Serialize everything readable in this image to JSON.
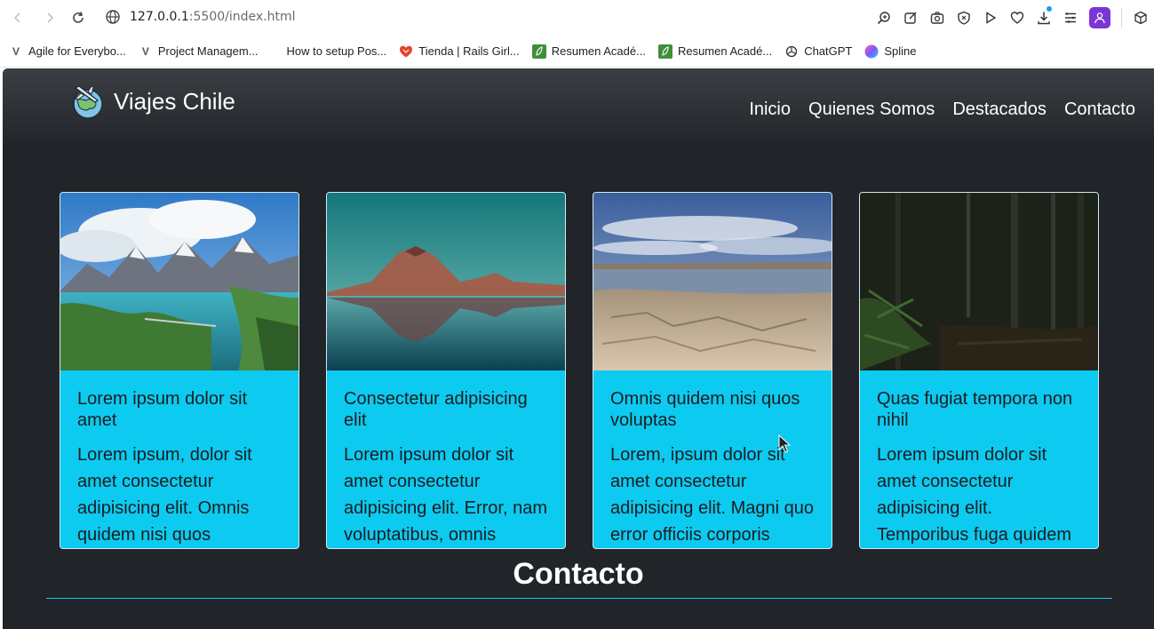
{
  "browser": {
    "url_host": "127.0.0.1",
    "url_rest": ":5500/index.html",
    "profile_color": "#7a37d6",
    "nav_icons": [
      "back-icon",
      "forward-icon",
      "reload-icon"
    ],
    "toolbar_icons": [
      "zoom-icon",
      "edit-icon",
      "screenshot-icon",
      "shield-icon",
      "play-icon",
      "heart-icon",
      "download-icon",
      "menu-icon",
      "profile-icon",
      "extensions-icon"
    ]
  },
  "bookmarks": [
    {
      "label": "Agile for Everybo...",
      "icon": "v"
    },
    {
      "label": "Project Managem...",
      "icon": "v"
    },
    {
      "label": "How to setup Pos...",
      "icon": ""
    },
    {
      "label": "Tienda | Rails Girl...",
      "icon": "heart"
    },
    {
      "label": "Resumen Acadé...",
      "icon": "leaf"
    },
    {
      "label": "Resumen Acadé...",
      "icon": "leaf"
    },
    {
      "label": "ChatGPT",
      "icon": "gpt"
    },
    {
      "label": "Spline",
      "icon": "spline"
    }
  ],
  "site": {
    "brand": "Viajes Chile",
    "menu": [
      "Inicio",
      "Quienes Somos",
      "Destacados",
      "Contacto"
    ],
    "accent": "#0dcaf0",
    "background": "#212529"
  },
  "cards": [
    {
      "title": "Lorem ipsum dolor sit amet",
      "text": "Lorem ipsum, dolor sit amet consectetur adipisicing elit. Omnis quidem nisi quos"
    },
    {
      "title": "Consectetur adipisicing elit",
      "text": "Lorem ipsum dolor sit amet consectetur adipisicing elit. Error, nam voluptatibus, omnis"
    },
    {
      "title": "Omnis quidem nisi quos voluptas",
      "text": "Lorem, ipsum dolor sit amet consectetur adipisicing elit. Magni quo error officiis corporis"
    },
    {
      "title": "Quas fugiat tempora non nihil",
      "text": "Lorem ipsum dolor sit amet consectetur adipisicing elit. Temporibus fuga quidem"
    }
  ],
  "contact": {
    "heading": "Contacto"
  }
}
